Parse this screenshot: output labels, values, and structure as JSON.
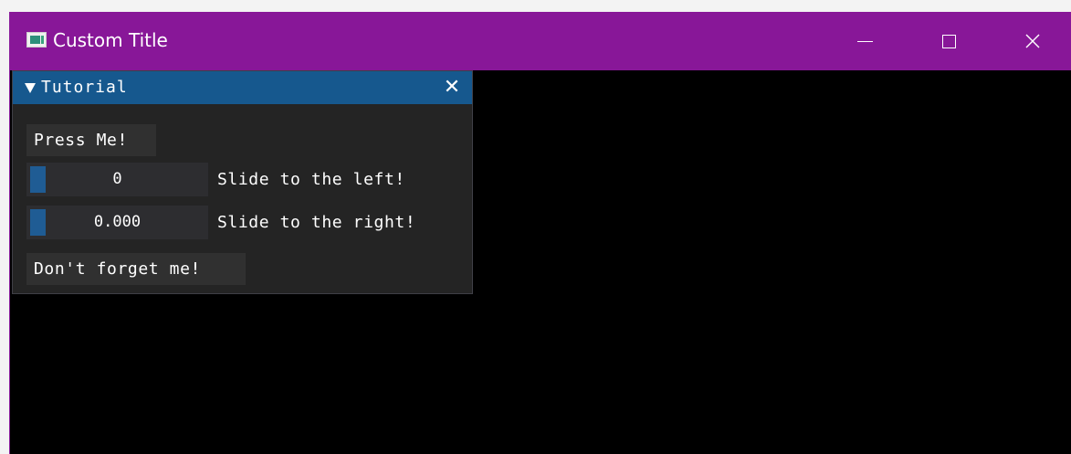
{
  "window": {
    "title": "Custom Title",
    "app_icon": "app-window-icon",
    "titlebar_color": "#881798",
    "controls": {
      "minimize_icon": "minimize-icon",
      "maximize_icon": "maximize-icon",
      "close_icon": "close-icon",
      "close_glyph": "✕"
    }
  },
  "tutorial": {
    "title": "Tutorial",
    "title_color": "#16588e",
    "collapse_icon": "triangle-down-icon",
    "close_glyph": "✕",
    "press_button_label": "Press Me!",
    "int_slider": {
      "value": "0",
      "label": "Slide to the left!"
    },
    "float_slider": {
      "value": "0.000",
      "label": "Slide to the right!"
    },
    "forget_button_label": "Don't forget me!"
  }
}
